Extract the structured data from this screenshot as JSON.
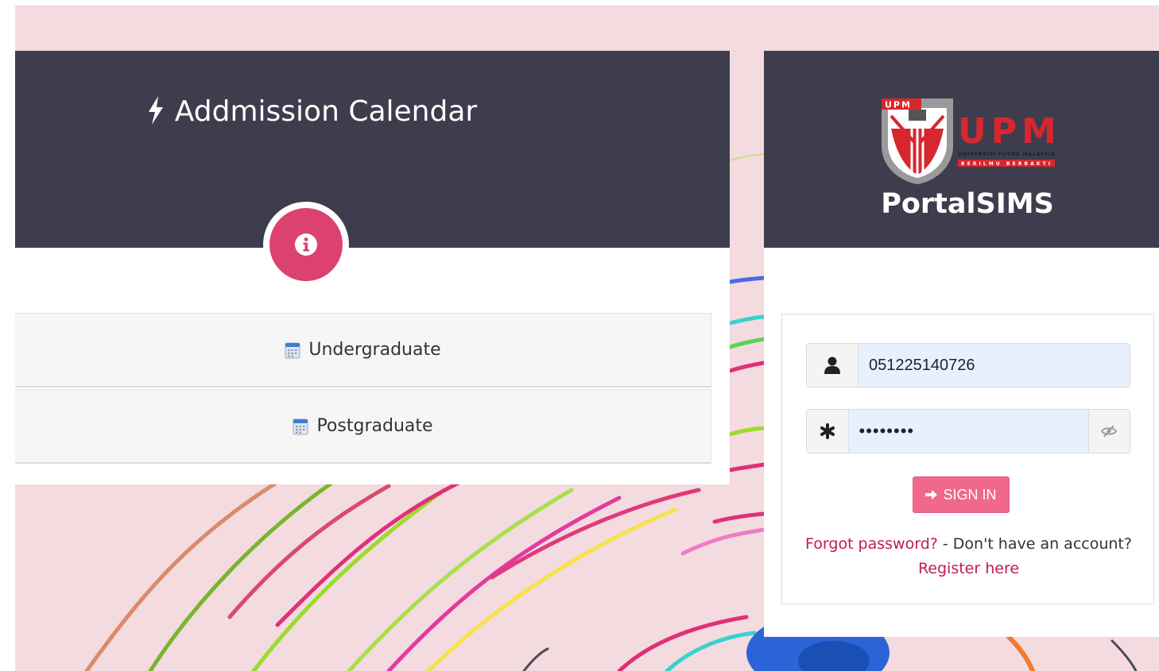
{
  "calendar": {
    "title": "Addmission Calendar",
    "items": [
      {
        "label": "Undergraduate",
        "icon": "calendar-icon"
      },
      {
        "label": "Postgraduate",
        "icon": "calendar-icon"
      }
    ],
    "badge_icon": "info-icon"
  },
  "portal": {
    "logo": {
      "wordmark": "UPM",
      "shield_text": "UPM",
      "subtitle": "UNIVERSITI PUTRA MALAYSIA",
      "motto": "BERILMU BERBAKTI"
    },
    "name": "PortalSIMS"
  },
  "login": {
    "username": {
      "value": "051225140726",
      "icon": "user-icon"
    },
    "password": {
      "value": "••••••••",
      "icon": "asterisk-icon",
      "toggle_icon": "eye-slash-icon"
    },
    "signin_label": "SIGN IN",
    "forgot_label": "Forgot password?",
    "separator": " - Don't have an account?",
    "register_label": "Register here"
  },
  "colors": {
    "header_bg": "#3e3d4d",
    "accent": "#db4270",
    "button": "#f0688a",
    "link": "#c2185b",
    "page_bg": "#f3dbe0"
  }
}
